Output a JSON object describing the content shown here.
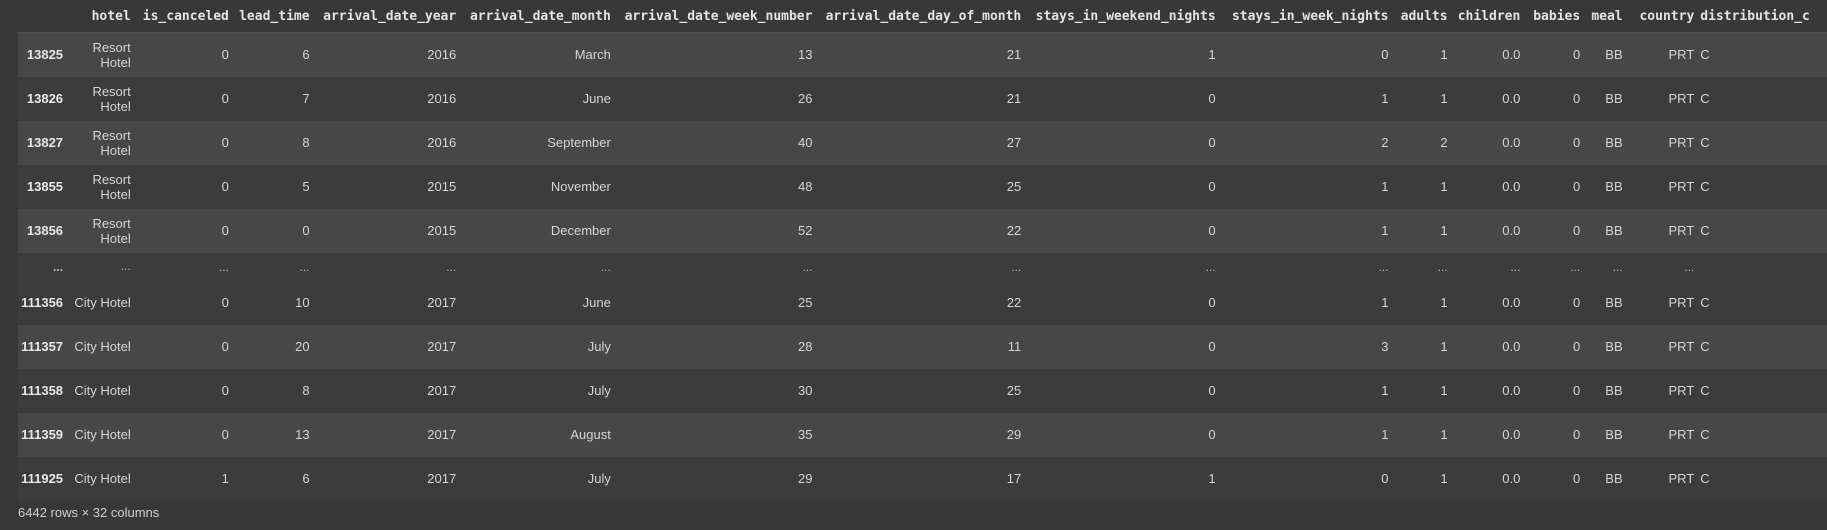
{
  "columns": [
    "hotel",
    "is_canceled",
    "lead_time",
    "arrival_date_year",
    "arrival_date_month",
    "arrival_date_week_number",
    "arrival_date_day_of_month",
    "stays_in_weekend_nights",
    "stays_in_week_nights",
    "adults",
    "children",
    "babies",
    "meal",
    "country",
    "distribution_c"
  ],
  "rows": [
    {
      "index": "13825",
      "cells": [
        "Resort Hotel",
        "0",
        "6",
        "2016",
        "March",
        "13",
        "21",
        "1",
        "0",
        "1",
        "0.0",
        "0",
        "BB",
        "PRT",
        "C"
      ]
    },
    {
      "index": "13826",
      "cells": [
        "Resort Hotel",
        "0",
        "7",
        "2016",
        "June",
        "26",
        "21",
        "0",
        "1",
        "1",
        "0.0",
        "0",
        "BB",
        "PRT",
        "C"
      ]
    },
    {
      "index": "13827",
      "cells": [
        "Resort Hotel",
        "0",
        "8",
        "2016",
        "September",
        "40",
        "27",
        "0",
        "2",
        "2",
        "0.0",
        "0",
        "BB",
        "PRT",
        "C"
      ]
    },
    {
      "index": "13855",
      "cells": [
        "Resort Hotel",
        "0",
        "5",
        "2015",
        "November",
        "48",
        "25",
        "0",
        "1",
        "1",
        "0.0",
        "0",
        "BB",
        "PRT",
        "C"
      ]
    },
    {
      "index": "13856",
      "cells": [
        "Resort Hotel",
        "0",
        "0",
        "2015",
        "December",
        "52",
        "22",
        "0",
        "1",
        "1",
        "0.0",
        "0",
        "BB",
        "PRT",
        "C"
      ]
    },
    {
      "index": "...",
      "ellipsis": true,
      "cells": [
        "...",
        "...",
        "...",
        "...",
        "...",
        "...",
        "...",
        "...",
        "...",
        "...",
        "...",
        "...",
        "...",
        "...",
        ""
      ]
    },
    {
      "index": "111356",
      "cells": [
        "City Hotel",
        "0",
        "10",
        "2017",
        "June",
        "25",
        "22",
        "0",
        "1",
        "1",
        "0.0",
        "0",
        "BB",
        "PRT",
        "C"
      ]
    },
    {
      "index": "111357",
      "cells": [
        "City Hotel",
        "0",
        "20",
        "2017",
        "July",
        "28",
        "11",
        "0",
        "3",
        "1",
        "0.0",
        "0",
        "BB",
        "PRT",
        "C"
      ]
    },
    {
      "index": "111358",
      "cells": [
        "City Hotel",
        "0",
        "8",
        "2017",
        "July",
        "30",
        "25",
        "0",
        "1",
        "1",
        "0.0",
        "0",
        "BB",
        "PRT",
        "C"
      ]
    },
    {
      "index": "111359",
      "cells": [
        "City Hotel",
        "0",
        "13",
        "2017",
        "August",
        "35",
        "29",
        "0",
        "1",
        "1",
        "0.0",
        "0",
        "BB",
        "PRT",
        "C"
      ]
    },
    {
      "index": "111925",
      "cells": [
        "City Hotel",
        "1",
        "6",
        "2017",
        "July",
        "29",
        "17",
        "1",
        "0",
        "1",
        "0.0",
        "0",
        "BB",
        "PRT",
        "C"
      ]
    }
  ],
  "summary": "6442 rows × 32 columns"
}
